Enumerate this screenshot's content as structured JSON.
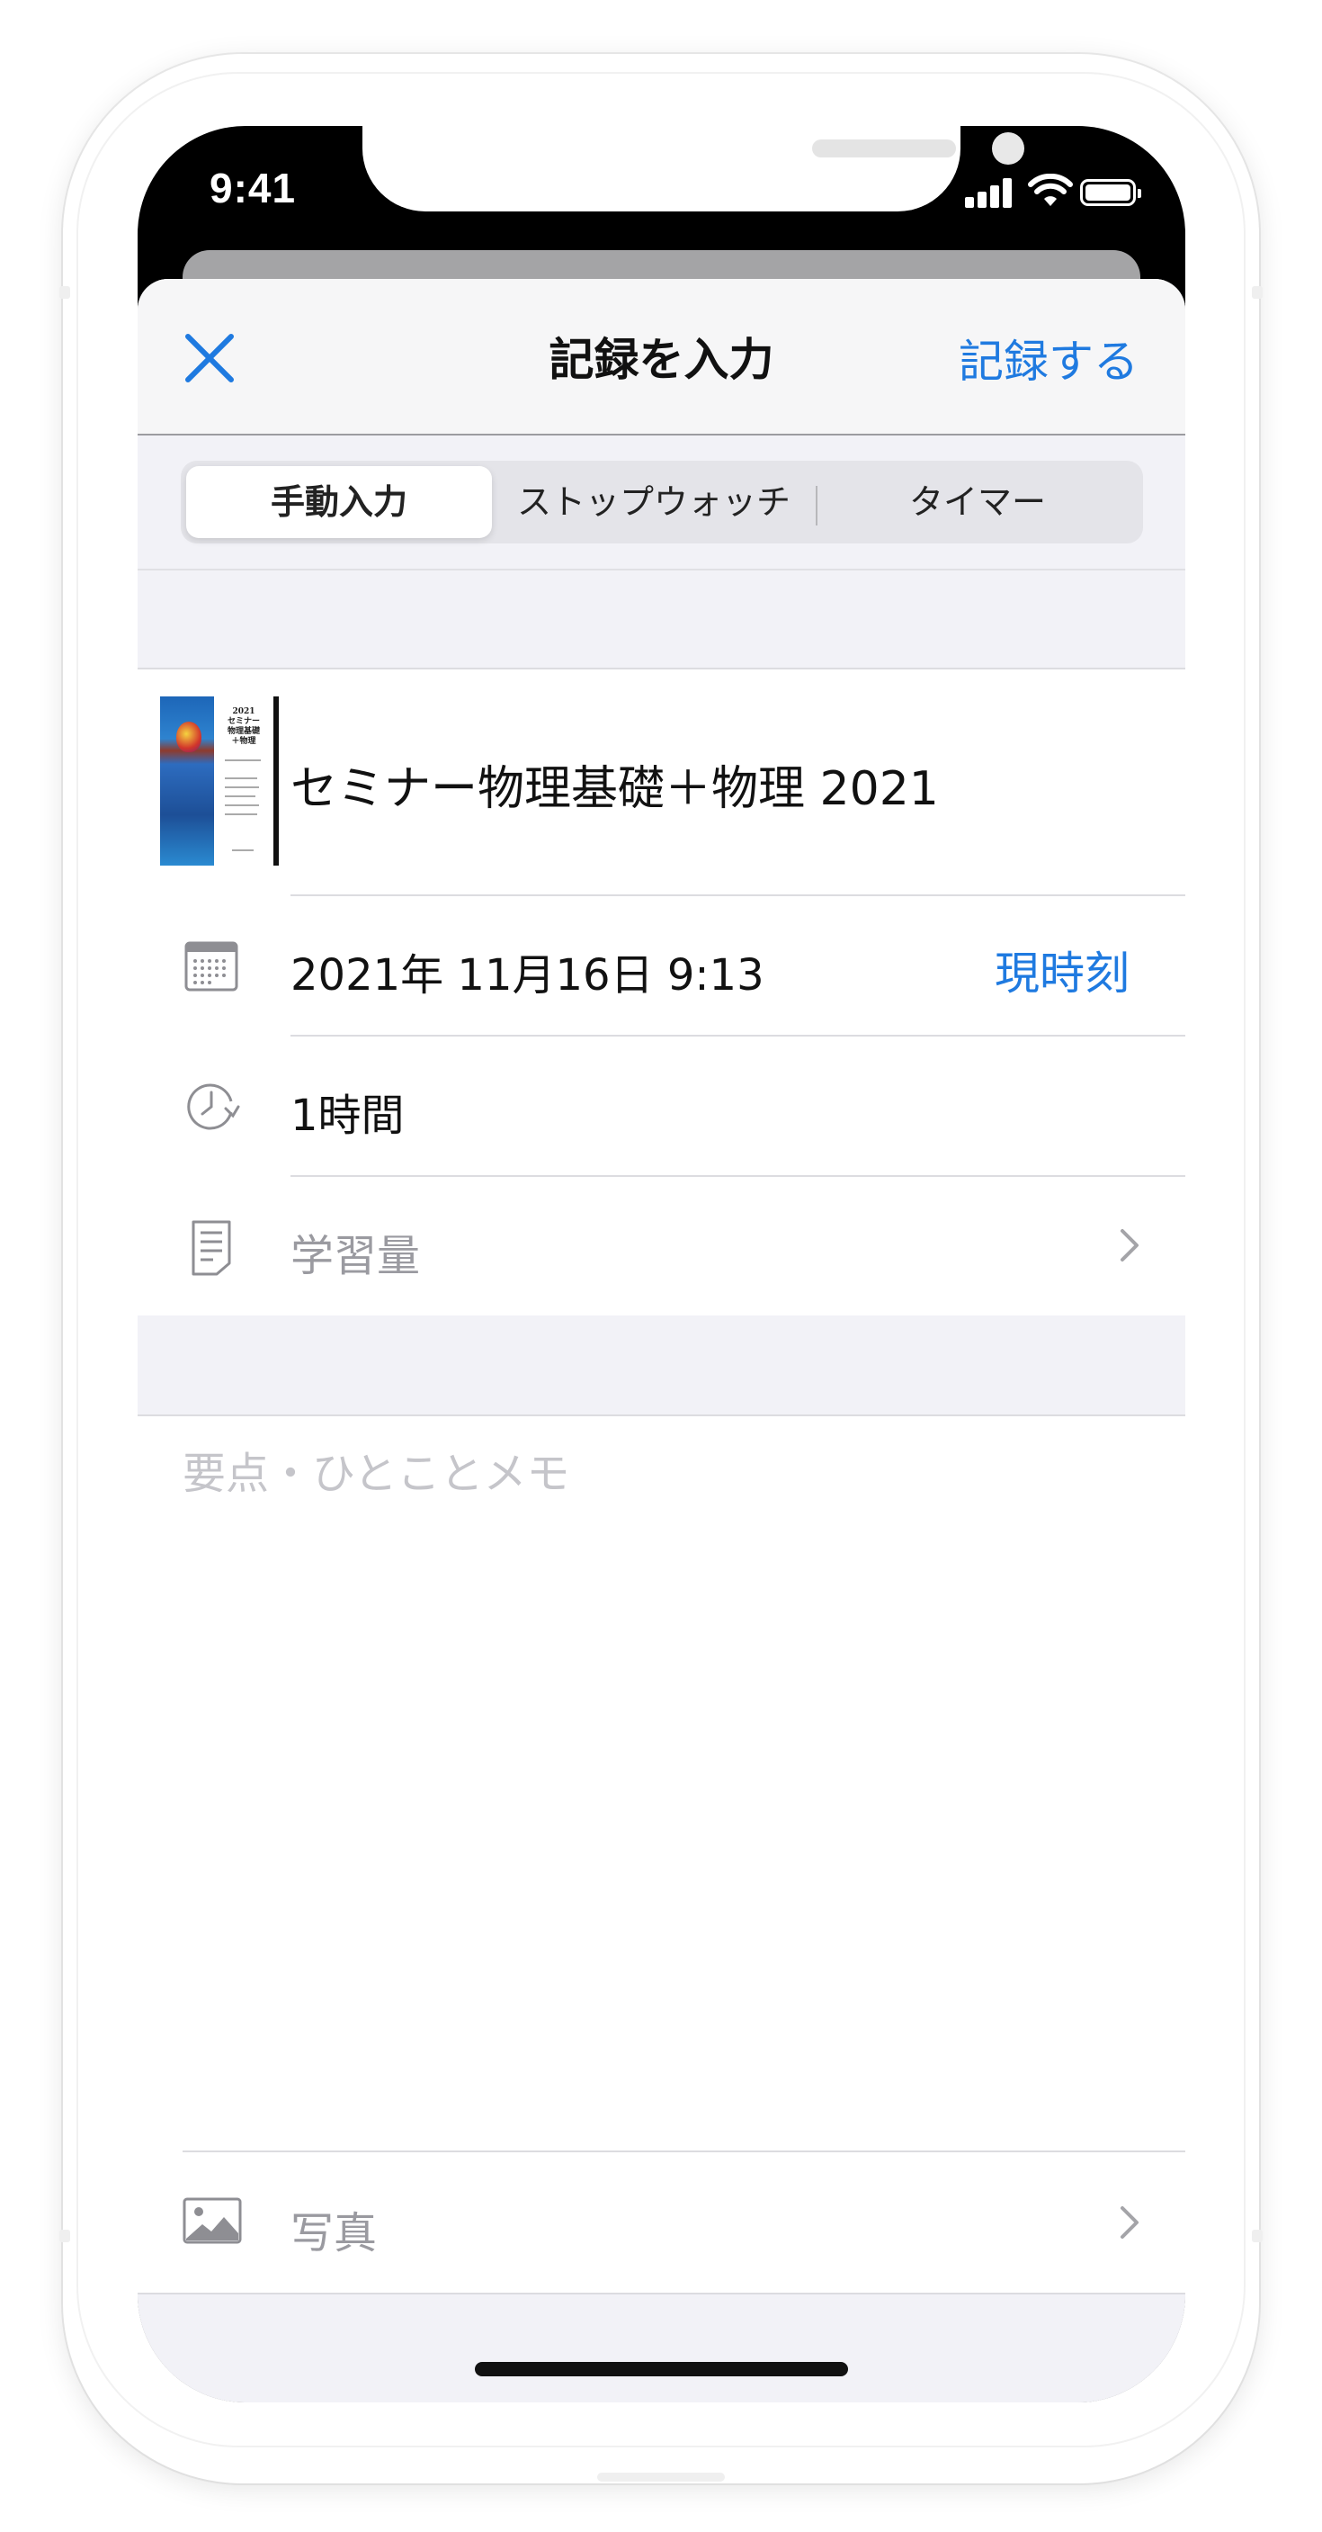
{
  "status_bar": {
    "time": "9:41"
  },
  "nav": {
    "title": "記録を入力",
    "action": "記録する",
    "close_icon": "close-icon"
  },
  "segments": {
    "items": [
      "手動入力",
      "ストップウォッチ",
      "タイマー"
    ],
    "selected": "手動入力"
  },
  "book": {
    "title": "セミナー物理基礎＋物理 2021",
    "cover_text": "2021 セミナー 物理基礎 ＋物理"
  },
  "fields": {
    "datetime": {
      "value": "2021年 11月16日 9:13",
      "action": "現時刻",
      "icon": "calendar-icon"
    },
    "duration": {
      "value": "1時間",
      "icon": "clock-icon"
    },
    "amount": {
      "placeholder": "学習量",
      "icon": "document-icon"
    }
  },
  "memo": {
    "placeholder": "要点・ひとことメモ"
  },
  "photo": {
    "label": "写真",
    "icon": "photo-icon"
  },
  "colors": {
    "accent": "#1f7ae0",
    "placeholder": "#9a9aa0",
    "background": "#f2f2f7"
  }
}
